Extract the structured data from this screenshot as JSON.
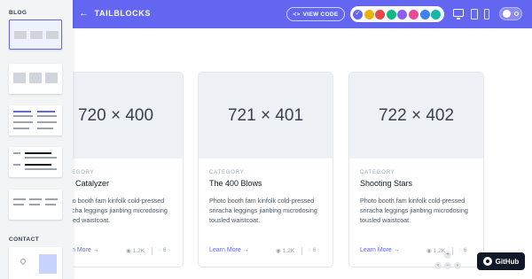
{
  "header": {
    "brand": "TAILBLOCKS",
    "view_code_label": "VIEW CODE",
    "colors": [
      {
        "name": "indigo",
        "hex": "#6366f1",
        "selected": true
      },
      {
        "name": "yellow",
        "hex": "#eab308"
      },
      {
        "name": "red",
        "hex": "#ef4444"
      },
      {
        "name": "green",
        "hex": "#10b981"
      },
      {
        "name": "purple",
        "hex": "#8b5cf6"
      },
      {
        "name": "pink",
        "hex": "#ec4899"
      },
      {
        "name": "blue",
        "hex": "#3b82f6"
      },
      {
        "name": "teal",
        "hex": "#14b8a6"
      }
    ]
  },
  "sidebar": {
    "sections": [
      {
        "title": "BLOG"
      },
      {
        "title": "CONTACT"
      }
    ]
  },
  "cards": [
    {
      "image": "720 × 400",
      "category": "CATEGORY",
      "title": "The Catalyzer",
      "description": "Photo booth fam kinfolk cold-pressed sriracha leggings jianbing microdosing tousled waistcoat.",
      "link": "Learn More →",
      "views": "1.2K",
      "comments": "6"
    },
    {
      "image": "721 × 401",
      "category": "CATEGORY",
      "title": "The 400 Blows",
      "description": "Photo booth fam kinfolk cold-pressed sriracha leggings jianbing microdosing tousled waistcoat.",
      "link": "Learn More →",
      "views": "1.2K",
      "comments": "6"
    },
    {
      "image": "722 × 402",
      "category": "CATEGORY",
      "title": "Shooting Stars",
      "description": "Photo booth fam kinfolk cold-pressed sriracha leggings jianbing microdosing tousled waistcoat.",
      "link": "Learn More →",
      "views": "1.2K",
      "comments": "6"
    }
  ],
  "github_label": "GitHub"
}
